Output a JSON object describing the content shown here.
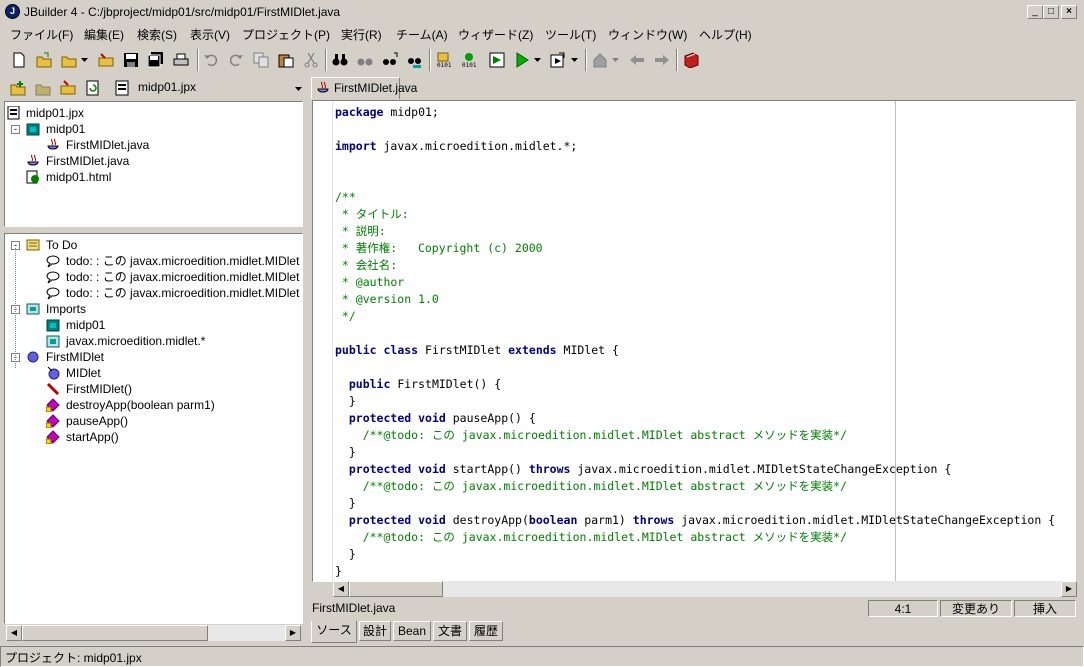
{
  "window": {
    "title": "JBuilder 4 - C:/jbproject/midp01/src/midp01/FirstMIDlet.java",
    "app_icon_letter": "J",
    "min_glyph": "_",
    "max_glyph": "□",
    "close_glyph": "×"
  },
  "menu": [
    {
      "label": "ファイル(F)"
    },
    {
      "label": "編集(E)"
    },
    {
      "label": "検索(S)"
    },
    {
      "label": "表示(V)"
    },
    {
      "label": "プロジェクト(P)"
    },
    {
      "label": "実行(R)"
    },
    {
      "label": "チーム(A)"
    },
    {
      "label": "ウィザード(Z)"
    },
    {
      "label": "ツール(T)"
    },
    {
      "label": "ウィンドウ(W)"
    },
    {
      "label": "ヘルプ(H)"
    }
  ],
  "project_selector": {
    "value": "midp01.jpx"
  },
  "project_tree": [
    {
      "label": "midp01.jpx"
    },
    {
      "label": "midp01",
      "expander": "-"
    },
    {
      "label": "FirstMIDlet.java"
    },
    {
      "label": "FirstMIDlet.java"
    },
    {
      "label": "midp01.html"
    }
  ],
  "structure_tree": [
    {
      "label": "To Do",
      "expander": "-"
    },
    {
      "label": "todo: : この javax.microedition.midlet.MIDlet"
    },
    {
      "label": "todo: : この javax.microedition.midlet.MIDlet"
    },
    {
      "label": "todo: : この javax.microedition.midlet.MIDlet"
    },
    {
      "label": "Imports",
      "expander": "-"
    },
    {
      "label": "midp01"
    },
    {
      "label": "javax.microedition.midlet.*"
    },
    {
      "label": "FirstMIDlet",
      "expander": "-"
    },
    {
      "label": "MIDlet"
    },
    {
      "label": "FirstMIDlet()"
    },
    {
      "label": "destroyApp(boolean parm1)"
    },
    {
      "label": "pauseApp()"
    },
    {
      "label": "startApp()"
    }
  ],
  "editor": {
    "file_tab": "FirstMIDlet.java",
    "status_file": "FirstMIDlet.java",
    "cursor_pos": "4:1",
    "modified": "変更あり",
    "insert_mode": "挿入",
    "code": [
      [
        {
          "t": "package",
          "c": "kw"
        },
        {
          "t": " midp01;"
        }
      ],
      [],
      [
        {
          "t": "import",
          "c": "kw"
        },
        {
          "t": " javax.microedition.midlet.*;"
        }
      ],
      [],
      [],
      [
        {
          "t": "/**",
          "c": "cm"
        }
      ],
      [
        {
          "t": " * タイトル:",
          "c": "cm"
        }
      ],
      [
        {
          "t": " * 説明:",
          "c": "cm"
        }
      ],
      [
        {
          "t": " * 著作権:   Copyright (c) 2000",
          "c": "cm"
        }
      ],
      [
        {
          "t": " * 会社名:",
          "c": "cm"
        }
      ],
      [
        {
          "t": " * @author",
          "c": "cm"
        }
      ],
      [
        {
          "t": " * @version 1.0",
          "c": "cm"
        }
      ],
      [
        {
          "t": " */",
          "c": "cm"
        }
      ],
      [],
      [
        {
          "t": "public",
          "c": "kw"
        },
        {
          "t": " "
        },
        {
          "t": "class",
          "c": "kw"
        },
        {
          "t": " FirstMIDlet "
        },
        {
          "t": "extends",
          "c": "kw"
        },
        {
          "t": " MIDlet {"
        }
      ],
      [],
      [
        {
          "t": "  "
        },
        {
          "t": "public",
          "c": "kw"
        },
        {
          "t": " FirstMIDlet() {"
        }
      ],
      [
        {
          "t": "  }"
        }
      ],
      [
        {
          "t": "  "
        },
        {
          "t": "protected",
          "c": "kw"
        },
        {
          "t": " "
        },
        {
          "t": "void",
          "c": "kw"
        },
        {
          "t": " pauseApp() {"
        }
      ],
      [
        {
          "t": "    /**@todo: この javax.microedition.midlet.MIDlet abstract メソッドを実装*/",
          "c": "cm"
        }
      ],
      [
        {
          "t": "  }"
        }
      ],
      [
        {
          "t": "  "
        },
        {
          "t": "protected",
          "c": "kw"
        },
        {
          "t": " "
        },
        {
          "t": "void",
          "c": "kw"
        },
        {
          "t": " startApp() "
        },
        {
          "t": "throws",
          "c": "kw"
        },
        {
          "t": " javax.microedition.midlet.MIDletStateChangeException {"
        }
      ],
      [
        {
          "t": "    /**@todo: この javax.microedition.midlet.MIDlet abstract メソッドを実装*/",
          "c": "cm"
        }
      ],
      [
        {
          "t": "  }"
        }
      ],
      [
        {
          "t": "  "
        },
        {
          "t": "protected",
          "c": "kw"
        },
        {
          "t": " "
        },
        {
          "t": "void",
          "c": "kw"
        },
        {
          "t": " destroyApp("
        },
        {
          "t": "boolean",
          "c": "kw"
        },
        {
          "t": " parm1) "
        },
        {
          "t": "throws",
          "c": "kw"
        },
        {
          "t": " javax.microedition.midlet.MIDletStateChangeException {"
        }
      ],
      [
        {
          "t": "    /**@todo: この javax.microedition.midlet.MIDlet abstract メソッドを実装*/",
          "c": "cm"
        }
      ],
      [
        {
          "t": "  }"
        }
      ],
      [
        {
          "t": "}"
        }
      ]
    ]
  },
  "bottom_tabs": [
    {
      "label": "ソース"
    },
    {
      "label": "設計"
    },
    {
      "label": "Bean"
    },
    {
      "label": "文書"
    },
    {
      "label": "履歴"
    }
  ],
  "statusbar": {
    "text": "プロジェクト: midp01.jpx"
  },
  "colors": {
    "keyword": "#000080",
    "comment": "#008000",
    "chrome": "#d4d0c8"
  }
}
